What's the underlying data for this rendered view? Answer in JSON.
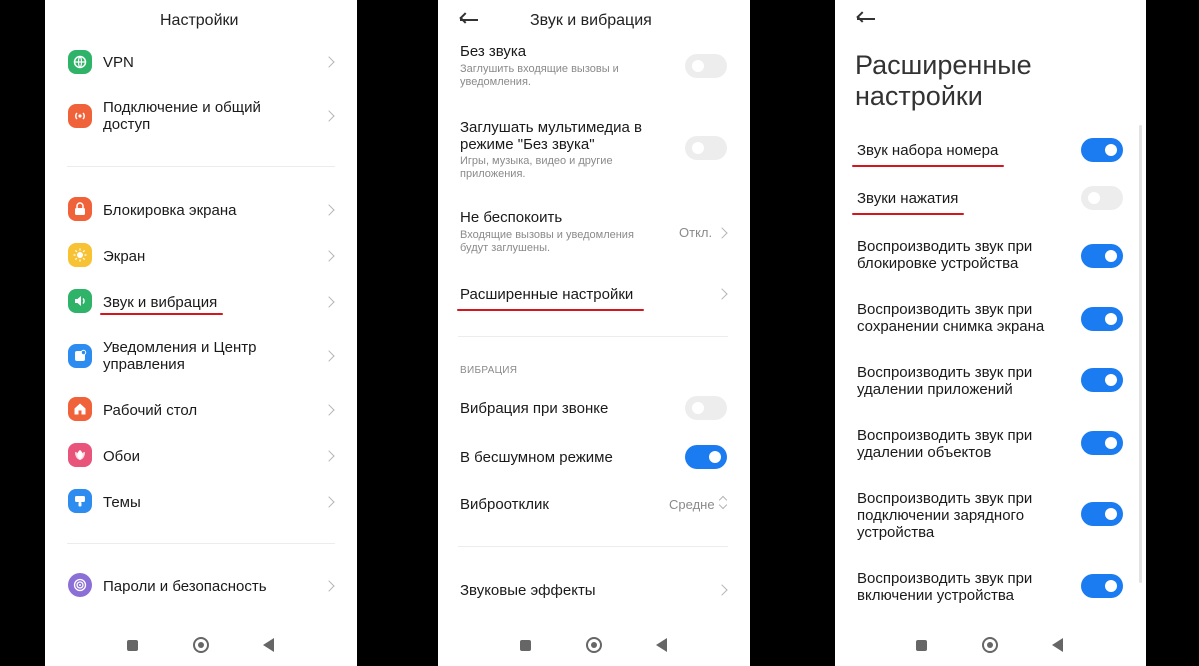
{
  "settings": {
    "title": "Настройки",
    "items": [
      {
        "label": "VPN",
        "icon": "vpn-icon",
        "color": "#2fb369"
      },
      {
        "label": "Подключение и общий доступ",
        "icon": "connection-sharing-icon",
        "color": "#f0623a"
      },
      {
        "label": "Блокировка экрана",
        "icon": "lock-screen-icon",
        "color": "#f0623a"
      },
      {
        "label": "Экран",
        "icon": "display-icon",
        "color": "#f7c233"
      },
      {
        "label": "Звук и вибрация",
        "icon": "sound-icon",
        "color": "#2fb369"
      },
      {
        "label": "Уведомления и Центр управления",
        "icon": "notifications-icon",
        "color": "#2d8cf0"
      },
      {
        "label": "Рабочий стол",
        "icon": "home-screen-icon",
        "color": "#f0623a"
      },
      {
        "label": "Обои",
        "icon": "wallpaper-icon",
        "color": "#e8547a"
      },
      {
        "label": "Темы",
        "icon": "themes-icon",
        "color": "#2d8cf0"
      },
      {
        "label": "Пароли и безопасность",
        "icon": "security-icon",
        "color": "#8b6fd6"
      }
    ]
  },
  "sound": {
    "title": "Звук и вибрация",
    "items": [
      {
        "label": "Без звука",
        "sub": "Заглушить входящие вызовы и уведомления.",
        "toggle": false
      },
      {
        "label": "Заглушать мультимедиа в режиме \"Без звука\"",
        "sub": "Игры, музыка, видео и другие приложения.",
        "toggle": false
      },
      {
        "label": "Не беспокоить",
        "sub": "Входящие вызовы и уведомления будут заглушены.",
        "value": "Откл."
      },
      {
        "label": "Расширенные настройки"
      }
    ],
    "section": "ВИБРАЦИЯ",
    "vibration": [
      {
        "label": "Вибрация при звонке",
        "toggle": false
      },
      {
        "label": "В бесшумном режиме",
        "toggle": true
      },
      {
        "label": "Виброотклик",
        "value": "Средне"
      }
    ],
    "effects": "Звуковые эффекты"
  },
  "advanced": {
    "title": "Расширенные настройки",
    "items": [
      {
        "label": "Звук набора номера",
        "toggle": true
      },
      {
        "label": "Звуки нажатия",
        "toggle": false
      },
      {
        "label": "Воспроизводить звук при блокировке устройства",
        "toggle": true
      },
      {
        "label": "Воспроизводить звук при сохранении снимка экрана",
        "toggle": true
      },
      {
        "label": "Воспроизводить звук при удалении приложений",
        "toggle": true
      },
      {
        "label": "Воспроизводить звук при удалении объектов",
        "toggle": true
      },
      {
        "label": "Воспроизводить звук при подключении зарядного устройства",
        "toggle": true
      },
      {
        "label": "Воспроизводить звук при включении устройства",
        "toggle": true
      }
    ]
  },
  "colors": {
    "accent": "#1a7cf0",
    "highlight": "#d4161e"
  }
}
